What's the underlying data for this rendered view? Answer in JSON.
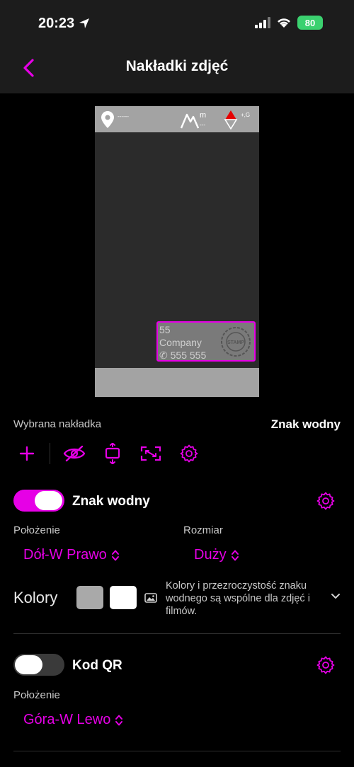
{
  "status": {
    "time": "20:23",
    "battery": "80"
  },
  "nav": {
    "title": "Nakładki zdjęć"
  },
  "preview": {
    "top_small_label": "------",
    "elevation_unit": "m",
    "elevation_value": "---",
    "compass_label": "+,G",
    "watermark_line1": "55",
    "watermark_line2": "Company",
    "watermark_line3": "✆ 555 555",
    "seal_text": "STAMP"
  },
  "selected": {
    "label": "Wybrana nakładka",
    "value": "Znak wodny"
  },
  "watermark": {
    "toggle_label": "Znak wodny",
    "enabled": true,
    "position_label": "Położenie",
    "position_value": "Dół-W Prawo",
    "size_label": "Rozmiar",
    "size_value": "Duży",
    "colors_label": "Kolory",
    "color1": "#a9a9a9",
    "color2": "#ffffff",
    "colors_note": "Kolory i przezroczystość znaku wodnego są wspólne dla zdjęć i filmów."
  },
  "qr": {
    "toggle_label": "Kod QR",
    "enabled": false,
    "position_label": "Położenie",
    "position_value": "Góra-W Lewo"
  },
  "icons": {
    "back": "chevron-left-icon",
    "add": "plus-icon",
    "hide": "eye-off-icon",
    "align": "vertical-align-icon",
    "resize": "resize-icon",
    "settings": "gear-icon"
  },
  "accent": "#e600e6"
}
